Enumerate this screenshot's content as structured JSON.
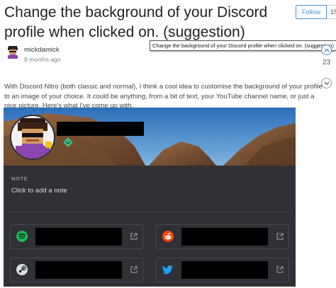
{
  "post": {
    "title": "Change the background of your Discord profile when clicked on. (suggestion)",
    "author": "mickdamick",
    "time": "8 months ago",
    "body": "With Discord Nitro (both classic and normal), I think a cool idea to customise the background of your profile to an image of your choice. It could be anything, from a bit of text, your YouTube channel name, or just a nice picture. Here's what I've come up with."
  },
  "follow": {
    "label": "Follow",
    "count": "15"
  },
  "tooltip": "Change the background of your Discord profile when clicked on. (suggestion)",
  "vote": {
    "count": "23"
  },
  "profile_card": {
    "note_label": "NOTE",
    "note_placeholder": "Click to add a note",
    "connections": [
      {
        "service": "Spotify",
        "icon": "spotify-icon",
        "color": "#1db954"
      },
      {
        "service": "Reddit",
        "icon": "reddit-icon",
        "color": "#ff4500"
      },
      {
        "service": "Steam",
        "icon": "steam-icon",
        "color": "#1b2838"
      },
      {
        "service": "Twitter",
        "icon": "twitter-icon",
        "color": "#1da1f2"
      }
    ]
  },
  "colors": {
    "accent": "#4a90d9",
    "card_bg": "#2f3136",
    "badge": "#41b883"
  }
}
